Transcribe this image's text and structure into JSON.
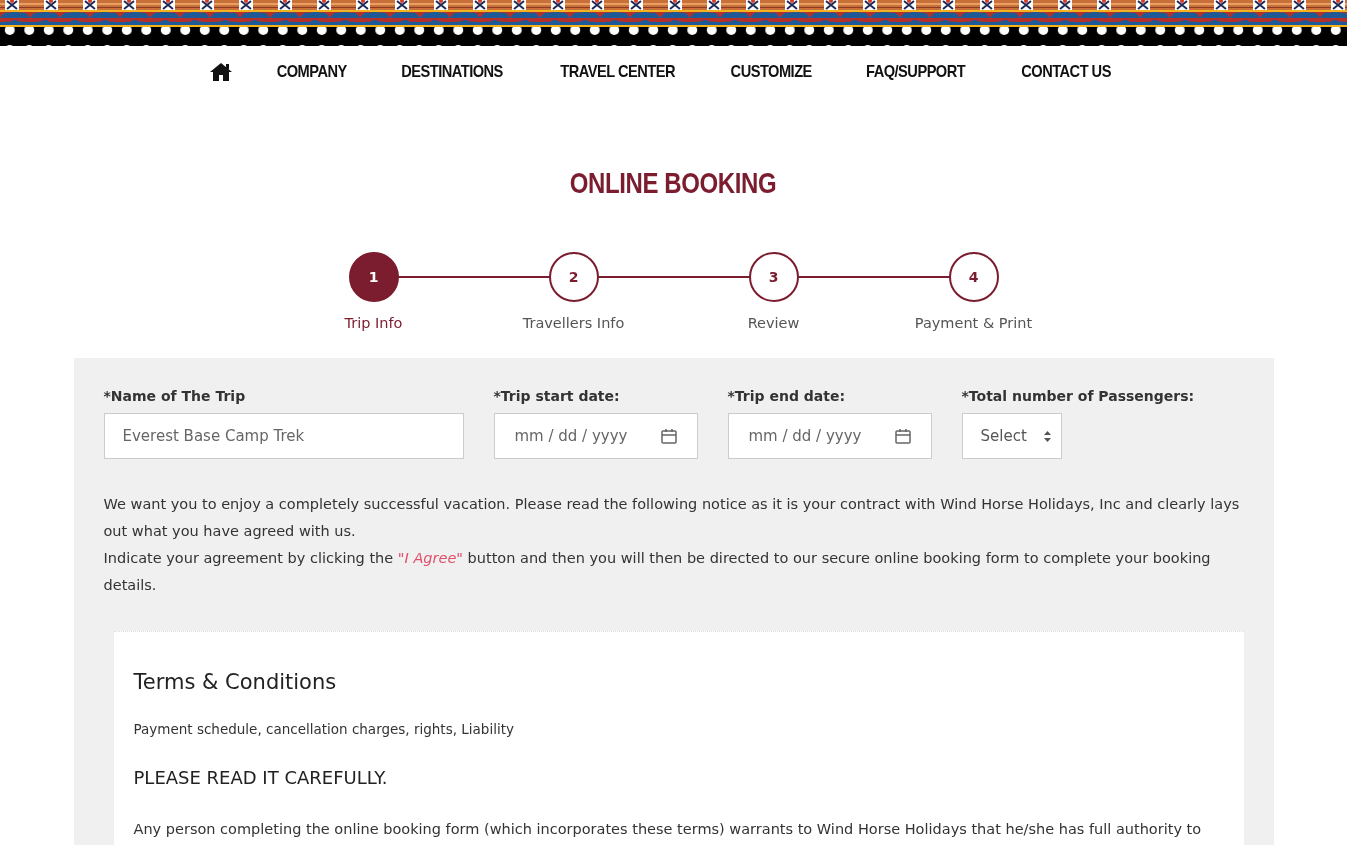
{
  "nav": {
    "items": [
      "COMPANY",
      "DESTINATIONS",
      "TRAVEL CENTER",
      "CUSTOMIZE",
      "FAQ/SUPPORT",
      "CONTACT US"
    ]
  },
  "page_title": "ONLINE BOOKING",
  "steps": [
    {
      "number": "1",
      "label": "Trip Info",
      "selected": true
    },
    {
      "number": "2",
      "label": "Travellers Info",
      "selected": false
    },
    {
      "number": "3",
      "label": "Review",
      "selected": false
    },
    {
      "number": "4",
      "label": "Payment & Print",
      "selected": false
    }
  ],
  "form": {
    "fields": [
      {
        "kind": "text",
        "label": "*Name of The Trip",
        "placeholder": "Everest Base Camp Trek"
      },
      {
        "kind": "date",
        "label": "*Trip start date:",
        "placeholder": "mm / dd / yyyy"
      },
      {
        "kind": "date",
        "label": "*Trip end date:",
        "placeholder": "mm / dd / yyyy"
      },
      {
        "kind": "select",
        "label": "*Total number of Passengers:",
        "value": "Select"
      }
    ]
  },
  "notice": [
    "We want you to enjoy a completely successful vacation. Please read the following notice as it is your contract with Wind Horse Holidays, Inc and clearly lays out what you have agreed with us.",
    "Indicate your agreement by clicking the *\"I Agree\"* button and then you will then be directed to our secure online booking form to complete your booking details."
  ],
  "terms": {
    "title": "Terms & Conditions",
    "subtitle": "Payment schedule, cancellation charges, rights, Liability",
    "heading": "PLEASE READ IT CAREFULLY.",
    "body": "Any person completing the online booking form (which incorporates these terms) warrants to Wind Horse Holidays that he/she has full authority to"
  }
}
